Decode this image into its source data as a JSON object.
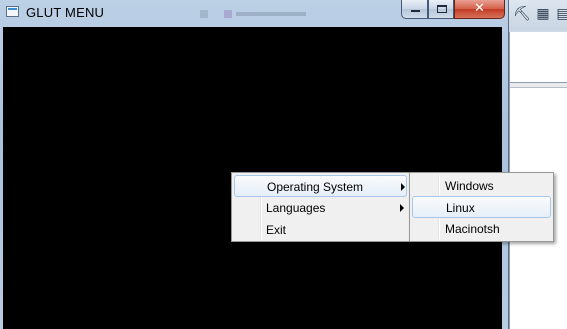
{
  "window": {
    "title": "GLUT MENU",
    "caption_buttons": {
      "minimize": "minimize",
      "maximize": "maximize",
      "close": "✕"
    }
  },
  "main_menu": {
    "items": [
      {
        "label": "Operating System",
        "has_submenu": true,
        "highlighted": true
      },
      {
        "label": "Languages",
        "has_submenu": true,
        "highlighted": false
      },
      {
        "label": "Exit",
        "has_submenu": false,
        "highlighted": false
      }
    ]
  },
  "submenu": {
    "items": [
      {
        "label": "Windows",
        "highlighted": false
      },
      {
        "label": "Linux",
        "highlighted": true
      },
      {
        "label": "Macinotsh",
        "highlighted": false
      }
    ]
  },
  "colors": {
    "client_background": "#000000",
    "menu_background": "#f0f0f0",
    "highlight_border": "#a8c8ea",
    "close_button": "#c13a22"
  },
  "icons": {
    "app": "application-icon",
    "bg_toolbar": [
      "shovel-icon",
      "calendar-icon",
      "file-icon"
    ]
  }
}
